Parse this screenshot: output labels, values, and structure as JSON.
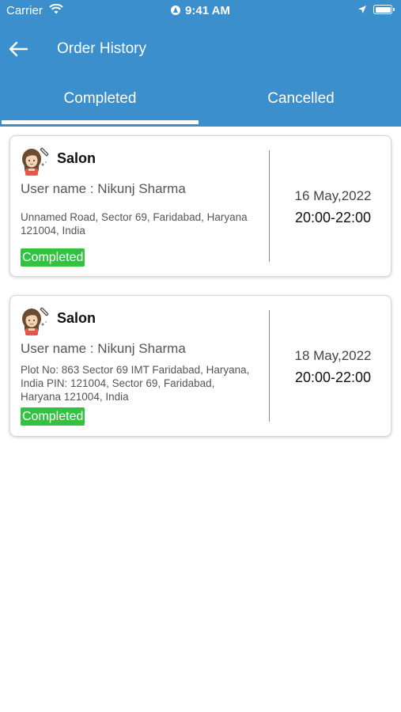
{
  "status_bar": {
    "carrier": "Carrier",
    "time": "9:41 AM"
  },
  "header": {
    "title": "Order History"
  },
  "tabs": [
    {
      "label": "Completed"
    },
    {
      "label": "Cancelled"
    }
  ],
  "orders": [
    {
      "service": "Salon",
      "user": "User name : Nikunj Sharma",
      "address": "Unnamed Road, Sector 69, Faridabad, Haryana 121004, India",
      "status": "Completed",
      "date": "16 May,2022",
      "time": "20:00-22:00"
    },
    {
      "service": "Salon",
      "user": "User name : Nikunj Sharma",
      "address": "Plot No: 863 Sector 69 IMT Faridabad, Haryana, India PIN: 121004, Sector 69, Faridabad, Haryana 121004, India",
      "status": "Completed",
      "date": "18 May,2022",
      "time": "20:00-22:00"
    }
  ],
  "colors": {
    "header": "#3b8fcc",
    "status_completed": "#33c141"
  },
  "icons": {
    "back": "arrow-left-icon",
    "service": "salon-icon"
  }
}
